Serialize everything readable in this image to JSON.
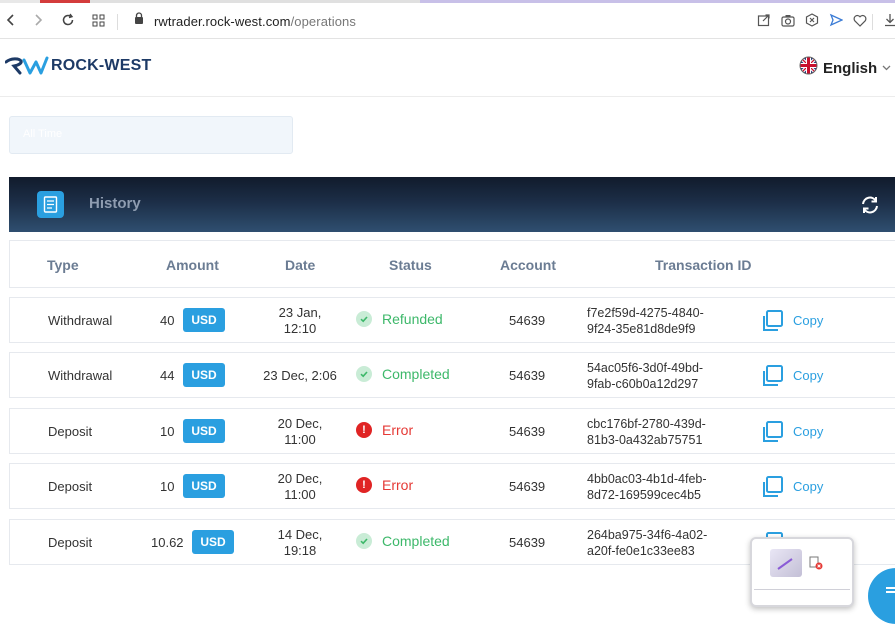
{
  "browser": {
    "url_host": "rwtrader.rock-west.com",
    "url_path": "/operations"
  },
  "header": {
    "logo_text": "ROCK-WEST",
    "language": "English"
  },
  "filter": {
    "label": "All Time"
  },
  "history": {
    "title": "History"
  },
  "table": {
    "columns": [
      "Type",
      "Amount",
      "Date",
      "Status",
      "Account",
      "Transaction ID"
    ],
    "copy_label": "Copy",
    "rows": [
      {
        "type": "Withdrawal",
        "amount": "40",
        "currency": "USD",
        "date_line1": "23 Jan,",
        "date_line2": "12:10",
        "status": "Refunded",
        "status_kind": "ok",
        "account": "54639",
        "txid_line1": "f7e2f59d-4275-4840-",
        "txid_line2": "9f24-35e81d8de9f9"
      },
      {
        "type": "Withdrawal",
        "amount": "44",
        "currency": "USD",
        "date_line1": "23 Dec, 2:06",
        "date_line2": "",
        "status": "Completed",
        "status_kind": "ok",
        "account": "54639",
        "txid_line1": "54ac05f6-3d0f-49bd-",
        "txid_line2": "9fab-c60b0a12d297"
      },
      {
        "type": "Deposit",
        "amount": "10",
        "currency": "USD",
        "date_line1": "20 Dec,",
        "date_line2": "11:00",
        "status": "Error",
        "status_kind": "err",
        "account": "54639",
        "txid_line1": "cbc176bf-2780-439d-",
        "txid_line2": "81b3-0a432ab75751"
      },
      {
        "type": "Deposit",
        "amount": "10",
        "currency": "USD",
        "date_line1": "20 Dec,",
        "date_line2": "11:00",
        "status": "Error",
        "status_kind": "err",
        "account": "54639",
        "txid_line1": "4bb0ac03-4b1d-4feb-",
        "txid_line2": "8d72-169599cec4b5"
      },
      {
        "type": "Deposit",
        "amount": "10.62",
        "currency": "USD",
        "date_line1": "14 Dec,",
        "date_line2": "19:18",
        "status": "Completed",
        "status_kind": "ok",
        "account": "54639",
        "txid_line1": "264ba975-34f6-4a02-",
        "txid_line2": "a20f-fe0e1c33ee83"
      }
    ]
  },
  "colors": {
    "accent": "#2a9fe0",
    "success": "#3db86a",
    "error": "#e53935",
    "banner_dark": "#111b2c"
  },
  "icons": [
    "back-icon",
    "forward-icon",
    "reload-icon",
    "apps-icon",
    "lock-icon",
    "share-icon",
    "camera-icon",
    "close-circle-icon",
    "send-icon",
    "heart-icon",
    "download-icon",
    "uk-flag-icon",
    "chevron-down-icon",
    "receipt-icon",
    "refresh-icon",
    "copy-icon",
    "check-icon",
    "error-icon"
  ]
}
